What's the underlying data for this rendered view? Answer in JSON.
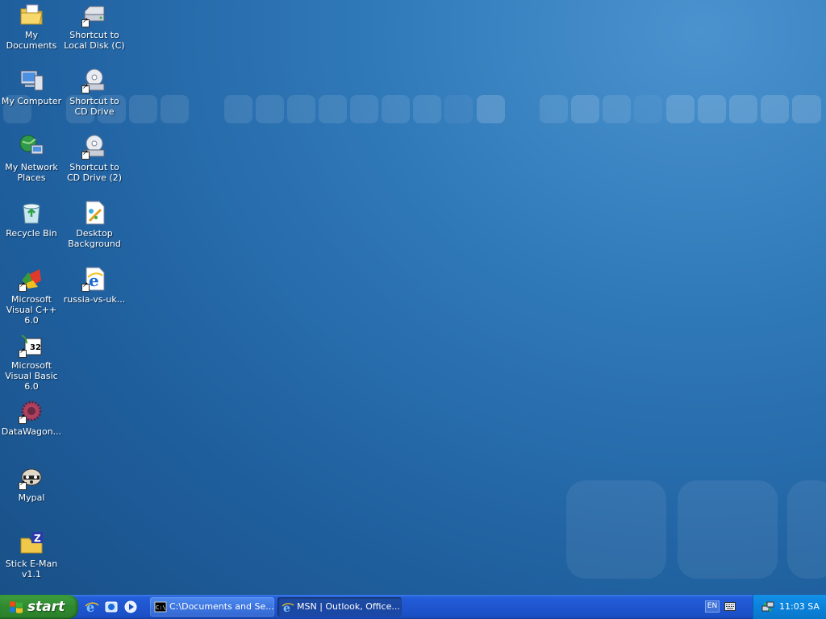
{
  "desktop": {
    "icons": [
      {
        "label": "My Documents",
        "icon": "my-documents-icon"
      },
      {
        "label": "Shortcut to Local Disk (C)",
        "icon": "hard-drive-icon"
      },
      {
        "label": "My Computer",
        "icon": "computer-icon"
      },
      {
        "label": "Shortcut to CD Drive",
        "icon": "cd-drive-icon"
      },
      {
        "label": "My Network Places",
        "icon": "network-icon"
      },
      {
        "label": "Shortcut to CD Drive (2)",
        "icon": "cd-drive-icon"
      },
      {
        "label": "Recycle Bin",
        "icon": "recycle-bin-icon"
      },
      {
        "label": "Desktop Background",
        "icon": "paint-icon"
      },
      {
        "label": "Microsoft Visual C++ 6.0",
        "icon": "visual-cpp-icon"
      },
      {
        "label": "russia-vs-uk...",
        "icon": "internet-explorer-icon"
      },
      {
        "label": "Microsoft Visual Basic 6.0",
        "icon": "visual-basic-icon"
      },
      {
        "label": "DataWagon...",
        "icon": "datawagon-icon"
      },
      {
        "label": "Mypal",
        "icon": "mypal-icon"
      },
      {
        "label": "Stick E-Man v1.1",
        "icon": "zip-folder-icon"
      }
    ]
  },
  "taskbar": {
    "start_label": "start",
    "quick_launch": [
      {
        "icon": "internet-explorer-icon"
      },
      {
        "icon": "outlook-express-icon"
      },
      {
        "icon": "media-player-icon"
      }
    ],
    "tasks": [
      {
        "label": "C:\\Documents and Se...",
        "icon": "command-prompt-icon",
        "active": false
      },
      {
        "label": "MSN | Outlook, Office...",
        "icon": "internet-explorer-icon",
        "active": true
      }
    ],
    "language": "EN",
    "clock": "11:03 SA"
  }
}
